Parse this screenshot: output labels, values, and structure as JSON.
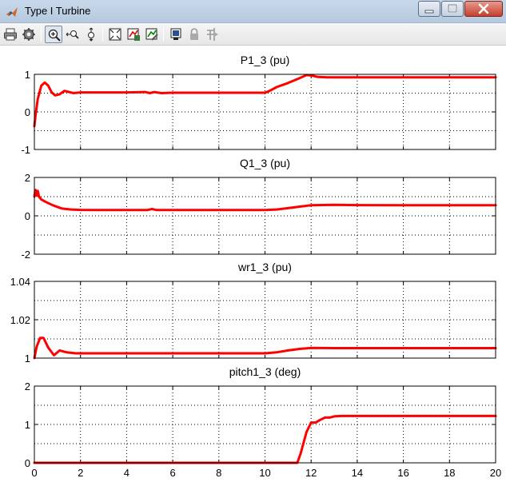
{
  "window": {
    "title": "Type I Turbine",
    "controls": [
      "minimize",
      "maximize",
      "close"
    ]
  },
  "toolbar": {
    "buttons": [
      "print-icon",
      "parameters-icon",
      "zoom-in-icon",
      "zoom-x-icon",
      "zoom-y-icon",
      "autoscale-icon",
      "save-axes-settings-icon",
      "restore-axes-settings-icon",
      "floating-scope-icon",
      "lock-axes-icon",
      "signal-selection-icon"
    ],
    "active": "zoom-in-icon"
  },
  "colors": {
    "trace": "#ff0000",
    "grid": "#000000",
    "axes": "#000000"
  },
  "chart_data": [
    {
      "type": "line",
      "title": "P1_3 (pu)",
      "xlim": [
        0,
        20
      ],
      "ylim": [
        -1,
        1
      ],
      "xticks": [],
      "xticklabels": [],
      "yticks": [
        -1,
        0,
        1
      ],
      "yticklabels": [
        "-1",
        "0",
        "1"
      ],
      "grid": true,
      "series": [
        {
          "x": [
            0,
            0.05,
            0.15,
            0.3,
            0.45,
            0.6,
            0.75,
            0.9,
            1.1,
            1.3,
            1.5,
            1.7,
            2,
            3,
            4,
            4.8,
            5,
            5.2,
            5.5,
            6,
            7,
            8,
            9,
            10,
            10.2,
            10.5,
            11,
            11.5,
            11.8,
            12,
            12.3,
            12.7,
            14,
            16,
            18,
            20
          ],
          "y": [
            -0.38,
            -0.1,
            0.35,
            0.7,
            0.78,
            0.7,
            0.52,
            0.44,
            0.47,
            0.56,
            0.53,
            0.5,
            0.52,
            0.52,
            0.52,
            0.53,
            0.5,
            0.53,
            0.5,
            0.51,
            0.51,
            0.51,
            0.51,
            0.51,
            0.56,
            0.66,
            0.77,
            0.9,
            0.98,
            0.97,
            0.93,
            0.92,
            0.92,
            0.92,
            0.92,
            0.92
          ]
        }
      ]
    },
    {
      "type": "line",
      "title": "Q1_3 (pu)",
      "xlim": [
        0,
        20
      ],
      "ylim": [
        -2,
        2
      ],
      "xticks": [],
      "xticklabels": [],
      "yticks": [
        -2,
        0,
        2
      ],
      "yticklabels": [
        "-2",
        "0",
        "2"
      ],
      "grid": true,
      "series": [
        {
          "x": [
            0,
            0.05,
            0.1,
            0.15,
            0.2,
            0.3,
            0.5,
            0.8,
            1.2,
            1.6,
            2,
            3,
            4,
            4.9,
            5.1,
            5.3,
            6,
            7,
            8,
            9,
            10,
            10.5,
            11,
            11.5,
            12,
            13,
            14,
            16,
            18,
            20
          ],
          "y": [
            1.0,
            1.35,
            1.05,
            1.3,
            1.0,
            0.85,
            0.72,
            0.55,
            0.38,
            0.33,
            0.31,
            0.3,
            0.3,
            0.3,
            0.36,
            0.3,
            0.3,
            0.3,
            0.3,
            0.3,
            0.3,
            0.33,
            0.4,
            0.48,
            0.55,
            0.57,
            0.56,
            0.55,
            0.55,
            0.55
          ]
        }
      ]
    },
    {
      "type": "line",
      "title": "wr1_3 (pu)",
      "xlim": [
        0,
        20
      ],
      "ylim": [
        1,
        1.04
      ],
      "xticks": [],
      "xticklabels": [],
      "yticks": [
        1,
        1.02,
        1.04
      ],
      "yticklabels": [
        "1",
        "1.02",
        "1.04"
      ],
      "grid": true,
      "series": [
        {
          "x": [
            0,
            0.1,
            0.25,
            0.4,
            0.6,
            0.85,
            1.1,
            1.4,
            1.8,
            2.5,
            4,
            6,
            8,
            10,
            10.5,
            11,
            11.5,
            12,
            13,
            14,
            16,
            18,
            20
          ],
          "y": [
            1.0,
            1.006,
            1.0105,
            1.0105,
            1.0055,
            1.0015,
            1.004,
            1.003,
            1.0025,
            1.0025,
            1.0025,
            1.0025,
            1.0025,
            1.0025,
            1.003,
            1.004,
            1.0048,
            1.0053,
            1.0052,
            1.0052,
            1.0052,
            1.0052,
            1.0052
          ]
        }
      ]
    },
    {
      "type": "line",
      "title": "pitch1_3 (deg)",
      "xlim": [
        0,
        20
      ],
      "ylim": [
        0,
        2
      ],
      "xticks": [
        0,
        2,
        4,
        6,
        8,
        10,
        12,
        14,
        16,
        18,
        20
      ],
      "xticklabels": [
        "0",
        "2",
        "4",
        "6",
        "8",
        "10",
        "12",
        "14",
        "16",
        "18",
        "20"
      ],
      "yticks": [
        0,
        1,
        2
      ],
      "yticklabels": [
        "0",
        "1",
        "2"
      ],
      "grid": true,
      "series": [
        {
          "x": [
            0,
            11.4,
            11.55,
            11.8,
            12.0,
            12.2,
            12.4,
            12.6,
            12.8,
            13.0,
            13.3,
            14,
            16,
            18,
            20
          ],
          "y": [
            0,
            0,
            0.25,
            0.8,
            1.05,
            1.05,
            1.12,
            1.18,
            1.18,
            1.21,
            1.22,
            1.22,
            1.22,
            1.22,
            1.22
          ]
        }
      ]
    }
  ]
}
